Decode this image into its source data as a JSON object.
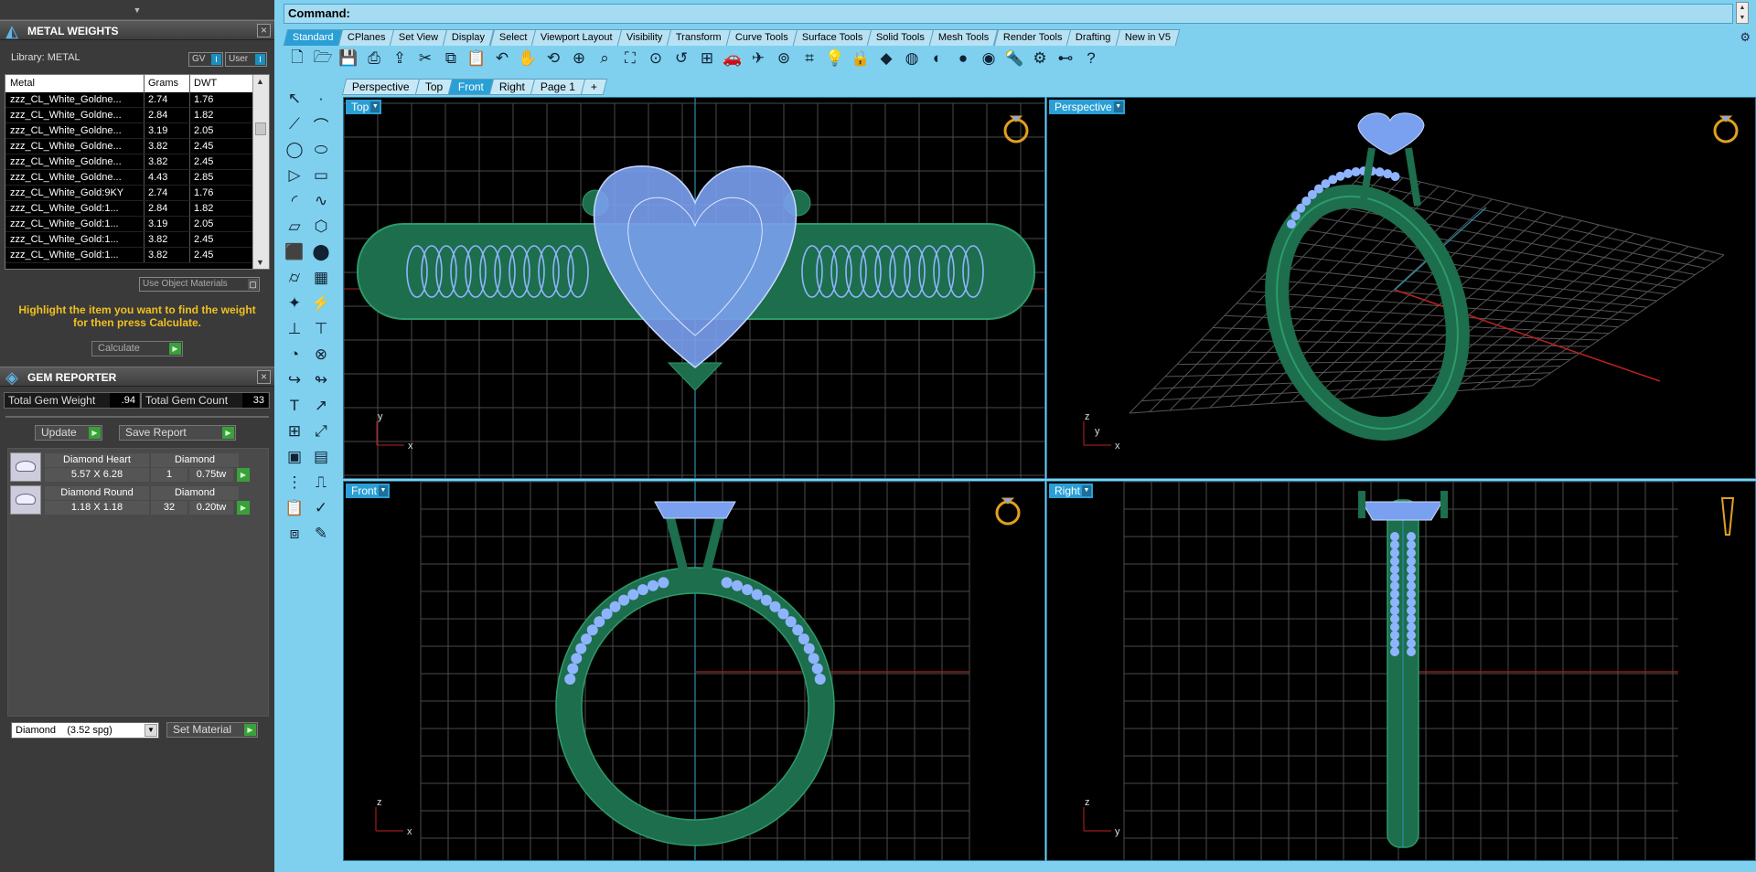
{
  "metal_weights": {
    "title": "METAL WEIGHTS",
    "library_label": "Library: METAL",
    "gv_label": "GV",
    "user_label": "User",
    "columns": [
      "Metal",
      "Grams",
      "DWT"
    ],
    "rows": [
      {
        "metal": "zzz_CL_White_Goldne...",
        "grams": "2.74",
        "dwt": "1.76"
      },
      {
        "metal": "zzz_CL_White_Goldne...",
        "grams": "2.84",
        "dwt": "1.82"
      },
      {
        "metal": "zzz_CL_White_Goldne...",
        "grams": "3.19",
        "dwt": "2.05"
      },
      {
        "metal": "zzz_CL_White_Goldne...",
        "grams": "3.82",
        "dwt": "2.45"
      },
      {
        "metal": "zzz_CL_White_Goldne...",
        "grams": "3.82",
        "dwt": "2.45"
      },
      {
        "metal": "zzz_CL_White_Goldne...",
        "grams": "4.43",
        "dwt": "2.85"
      },
      {
        "metal": "zzz_CL_White_Gold:9KY",
        "grams": "2.74",
        "dwt": "1.76"
      },
      {
        "metal": "zzz_CL_White_Gold:1...",
        "grams": "2.84",
        "dwt": "1.82"
      },
      {
        "metal": "zzz_CL_White_Gold:1...",
        "grams": "3.19",
        "dwt": "2.05"
      },
      {
        "metal": "zzz_CL_White_Gold:1...",
        "grams": "3.82",
        "dwt": "2.45"
      },
      {
        "metal": "zzz_CL_White_Gold:1...",
        "grams": "3.82",
        "dwt": "2.45"
      }
    ],
    "use_object_materials": "Use Object Materials",
    "hint": "Highlight the item you want to find the weight for then press Calculate.",
    "calculate_label": "Calculate"
  },
  "gem_reporter": {
    "title": "GEM REPORTER",
    "total_weight_label": "Total Gem Weight",
    "total_weight_value": ".94",
    "total_count_label": "Total Gem Count",
    "total_count_value": "33",
    "update_label": "Update",
    "save_label": "Save Report",
    "gems": [
      {
        "name": "Diamond Heart",
        "size": "5.57 X 6.28",
        "material": "Diamond",
        "count": "1",
        "weight": "0.75tw"
      },
      {
        "name": "Diamond Round",
        "size": "1.18 X 1.18",
        "material": "Diamond",
        "count": "32",
        "weight": "0.20tw"
      }
    ],
    "material_select": "Diamond    (3.52 spg)",
    "set_material_label": "Set Material"
  },
  "command": {
    "label": "Command:"
  },
  "toolbar_tabs": [
    "Standard",
    "CPlanes",
    "Set View",
    "Display",
    "Select",
    "Viewport Layout",
    "Visibility",
    "Transform",
    "Curve Tools",
    "Surface Tools",
    "Solid Tools",
    "Mesh Tools",
    "Render Tools",
    "Drafting",
    "New in V5"
  ],
  "active_toolbar_tab": "Standard",
  "toolbar_icons": [
    "new-icon",
    "open-icon",
    "save-icon",
    "print-icon",
    "import-icon",
    "cut-icon",
    "copy-icon",
    "paste-icon",
    "undo-icon",
    "pan-icon",
    "rotate-view-icon",
    "zoom-icon",
    "zoom-window-icon",
    "zoom-extents-icon",
    "zoom-selected-icon",
    "undo-view-icon",
    "four-viewports-icon",
    "car-icon",
    "plane-icon",
    "named-view-icon",
    "grid-snap-icon",
    "light-icon",
    "lock-icon",
    "material-icon",
    "color-wheel-icon",
    "shade-icon",
    "render-icon",
    "sphere-icon",
    "flashlight-icon",
    "gear-icon",
    "dimension-icon",
    "help-icon"
  ],
  "viewport_tabs": [
    "Perspective",
    "Top",
    "Front",
    "Right",
    "Page 1",
    "+"
  ],
  "active_viewport_tab": "Front",
  "viewports": {
    "top": {
      "label": "Top",
      "axis1": "y",
      "axis2": "x"
    },
    "perspective": {
      "label": "Perspective",
      "axis1": "z",
      "axis2": "y",
      "axis3": "x"
    },
    "front": {
      "label": "Front",
      "axis1": "z",
      "axis2": "x"
    },
    "right": {
      "label": "Right",
      "axis1": "z",
      "axis2": "y"
    }
  },
  "colors": {
    "accent": "#2a9fd6",
    "metal": "#1d6e4c",
    "gem": "#8fb4ff",
    "grid": "#4a4a4a",
    "hint": "#f0c020"
  }
}
